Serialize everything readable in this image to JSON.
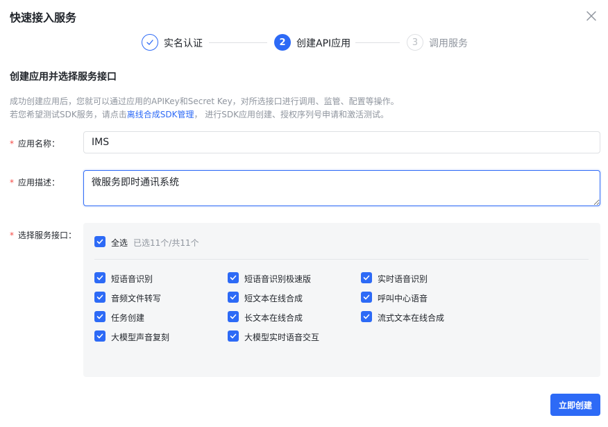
{
  "dialog": {
    "title": "快速接入服务",
    "close_icon": "close-icon"
  },
  "steps": [
    {
      "number": "1",
      "label": "实名认证",
      "status": "done",
      "icon": "check-icon"
    },
    {
      "number": "2",
      "label": "创建API应用",
      "status": "active"
    },
    {
      "number": "3",
      "label": "调用服务",
      "status": "wait"
    }
  ],
  "section": {
    "title": "创建应用并选择服务接口",
    "desc_line1": "成功创建应用后，您就可以通过应用的APIKey和Secret Key，对所选接口进行调用、监管、配置等操作。",
    "desc_line2_prefix": "若您希望测试SDK服务，请点击",
    "desc_line2_link": "离线合成SDK管理",
    "desc_line2_suffix": "， 进行SDK应用创建、授权序列号申请和激活测试。"
  },
  "form": {
    "name_label": "应用名称：",
    "name_value": "IMS",
    "desc_label": "应用描述：",
    "desc_value": "微服务即时通讯系统",
    "service_label": "选择服务接口："
  },
  "services": {
    "select_all_label": "全选",
    "selected_count": "已选11个/共11个",
    "items": [
      {
        "label": "短语音识别",
        "checked": true
      },
      {
        "label": "短语音识别极速版",
        "checked": true
      },
      {
        "label": "实时语音识别",
        "checked": true
      },
      {
        "label": "音频文件转写",
        "checked": true
      },
      {
        "label": "短文本在线合成",
        "checked": true
      },
      {
        "label": "呼叫中心语音",
        "checked": true
      },
      {
        "label": "任务创建",
        "checked": true
      },
      {
        "label": "长文本在线合成",
        "checked": true
      },
      {
        "label": "流式文本在线合成",
        "checked": true
      },
      {
        "label": "大模型声音复刻",
        "checked": true
      },
      {
        "label": "大模型实时语音交互",
        "checked": true
      }
    ]
  },
  "footer": {
    "submit_label": "立即创建"
  },
  "colors": {
    "primary": "#2d6af6",
    "required": "#f54a45",
    "muted": "#8f959e"
  }
}
